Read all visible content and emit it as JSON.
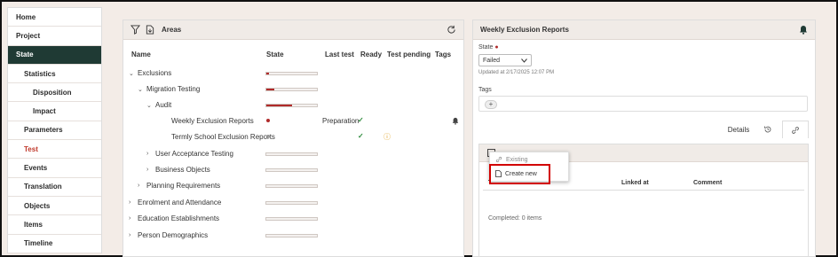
{
  "sidebar": {
    "items": [
      {
        "label": "Home",
        "level": 0,
        "active": false,
        "red": false
      },
      {
        "label": "Project",
        "level": 0,
        "active": false,
        "red": false
      },
      {
        "label": "State",
        "level": 0,
        "active": true,
        "red": false
      },
      {
        "label": "Statistics",
        "level": 1,
        "active": false,
        "red": false
      },
      {
        "label": "Disposition",
        "level": 2,
        "active": false,
        "red": false
      },
      {
        "label": "Impact",
        "level": 2,
        "active": false,
        "red": false
      },
      {
        "label": "Parameters",
        "level": 1,
        "active": false,
        "red": false
      },
      {
        "label": "Test",
        "level": 1,
        "active": false,
        "red": true
      },
      {
        "label": "Events",
        "level": 1,
        "active": false,
        "red": false
      },
      {
        "label": "Translation",
        "level": 1,
        "active": false,
        "red": false
      },
      {
        "label": "Objects",
        "level": 1,
        "active": false,
        "red": false
      },
      {
        "label": "Items",
        "level": 1,
        "active": false,
        "red": false
      },
      {
        "label": "Timeline",
        "level": 1,
        "active": false,
        "red": false
      }
    ]
  },
  "areas": {
    "title": "Areas",
    "columns": {
      "name": "Name",
      "state": "State",
      "last_test": "Last test",
      "ready": "Ready",
      "test_pending": "Test pending",
      "tags": "Tags"
    },
    "rows": [
      {
        "name": "Exclusions",
        "chev": "⌄",
        "indent": 0,
        "state": "bar",
        "progress": 0.05
      },
      {
        "name": "Migration Testing",
        "chev": "⌄",
        "indent": 1,
        "state": "bar",
        "progress": 0.15
      },
      {
        "name": "Audit",
        "chev": "⌄",
        "indent": 2,
        "state": "bar",
        "progress": 0.5
      },
      {
        "name": "Weekly Exclusion Reports",
        "chev": "",
        "indent": 3,
        "state": "dot",
        "last_test": "Preparation",
        "ready": "✓",
        "bell": true
      },
      {
        "name": "Termly School Exclusion Reports",
        "chev": "",
        "indent": 3,
        "state": "hollow",
        "ready": "✓",
        "pending": "ⓘ"
      },
      {
        "name": "User Acceptance Testing",
        "chev": "›",
        "indent": 2,
        "state": "bar",
        "progress": 0
      },
      {
        "name": "Business Objects",
        "chev": "›",
        "indent": 2,
        "state": "bar",
        "progress": 0
      },
      {
        "name": "Planning Requirements",
        "chev": "›",
        "indent": 1,
        "state": "bar",
        "progress": 0
      },
      {
        "name": "Enrolment and Attendance",
        "chev": "›",
        "indent": 0,
        "state": "bar",
        "progress": 0
      },
      {
        "name": "Education Establishments",
        "chev": "›",
        "indent": 0,
        "state": "bar",
        "progress": 0
      },
      {
        "name": "Person Demographics",
        "chev": "›",
        "indent": 0,
        "state": "bar",
        "progress": 0
      }
    ]
  },
  "weekly": {
    "title": "Weekly Exclusion Reports",
    "state_label": "State",
    "state_value": "Failed",
    "updated": "Updated at 2/17/2025 12:07 PM",
    "tags_label": "Tags",
    "tab_details": "Details",
    "table": {
      "linked_at": "Linked at",
      "comment": "Comment",
      "completed": "Completed: 0 items"
    },
    "popup": {
      "existing": "Existing",
      "create_new": "Create new"
    }
  },
  "colors": {
    "accent": "#1f3a34",
    "danger": "#b02a2a",
    "highlight": "#d20000"
  }
}
